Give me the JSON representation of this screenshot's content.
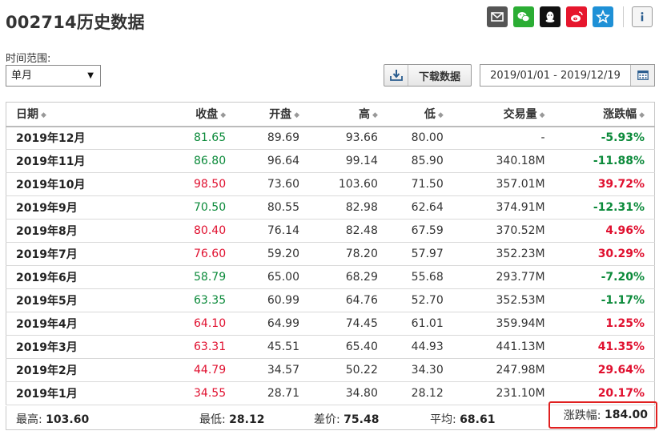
{
  "page": {
    "title": "002714历史数据"
  },
  "share": {
    "icons": [
      "email-icon",
      "wechat-icon",
      "qq-icon",
      "weibo-icon",
      "qzone-icon",
      "info-icon"
    ],
    "colors": {
      "email": "#555555",
      "wechat": "#2bad34",
      "qq": "#111111",
      "weibo": "#e6162d",
      "qzone": "#1e90d6"
    }
  },
  "range": {
    "label": "时间范围:",
    "selected": "单月"
  },
  "download": {
    "label": "下载数据"
  },
  "date_range": {
    "value": "2019/01/01 - 2019/12/19"
  },
  "table": {
    "headers": {
      "date": "日期",
      "close": "收盘",
      "open": "开盘",
      "high": "高",
      "low": "低",
      "volume": "交易量",
      "change": "涨跌幅"
    },
    "rows": [
      {
        "date": "2019年12月",
        "close": "81.65",
        "open": "89.69",
        "high": "93.66",
        "low": "80.00",
        "volume": "-",
        "change": "-5.93%",
        "dir": "down"
      },
      {
        "date": "2019年11月",
        "close": "86.80",
        "open": "96.64",
        "high": "99.14",
        "low": "85.90",
        "volume": "340.18M",
        "change": "-11.88%",
        "dir": "down"
      },
      {
        "date": "2019年10月",
        "close": "98.50",
        "open": "73.60",
        "high": "103.60",
        "low": "71.50",
        "volume": "357.01M",
        "change": "39.72%",
        "dir": "up"
      },
      {
        "date": "2019年9月",
        "close": "70.50",
        "open": "80.55",
        "high": "82.98",
        "low": "62.64",
        "volume": "374.91M",
        "change": "-12.31%",
        "dir": "down"
      },
      {
        "date": "2019年8月",
        "close": "80.40",
        "open": "76.14",
        "high": "82.48",
        "low": "67.59",
        "volume": "370.52M",
        "change": "4.96%",
        "dir": "up"
      },
      {
        "date": "2019年7月",
        "close": "76.60",
        "open": "59.20",
        "high": "78.20",
        "low": "57.97",
        "volume": "352.23M",
        "change": "30.29%",
        "dir": "up"
      },
      {
        "date": "2019年6月",
        "close": "58.79",
        "open": "65.00",
        "high": "68.29",
        "low": "55.68",
        "volume": "293.77M",
        "change": "-7.20%",
        "dir": "down"
      },
      {
        "date": "2019年5月",
        "close": "63.35",
        "open": "60.99",
        "high": "64.76",
        "low": "52.70",
        "volume": "352.53M",
        "change": "-1.17%",
        "dir": "down"
      },
      {
        "date": "2019年4月",
        "close": "64.10",
        "open": "64.99",
        "high": "74.45",
        "low": "61.01",
        "volume": "359.94M",
        "change": "1.25%",
        "dir": "up"
      },
      {
        "date": "2019年3月",
        "close": "63.31",
        "open": "45.51",
        "high": "65.40",
        "low": "44.93",
        "volume": "441.13M",
        "change": "41.35%",
        "dir": "up"
      },
      {
        "date": "2019年2月",
        "close": "44.79",
        "open": "34.57",
        "high": "50.22",
        "low": "34.30",
        "volume": "247.98M",
        "change": "29.64%",
        "dir": "up"
      },
      {
        "date": "2019年1月",
        "close": "34.55",
        "open": "28.71",
        "high": "34.80",
        "low": "28.12",
        "volume": "231.10M",
        "change": "20.17%",
        "dir": "up"
      }
    ]
  },
  "summary": {
    "high_label": "最高:",
    "high_value": "103.60",
    "low_label": "最低:",
    "low_value": "28.12",
    "diff_label": "差价:",
    "diff_value": "75.48",
    "avg_label": "平均:",
    "avg_value": "68.61",
    "change_label": "涨跌幅:",
    "change_value": "184.00"
  },
  "colors": {
    "up": "#e0102f",
    "down": "#0b8a3a",
    "highlight_border": "#e02020"
  }
}
